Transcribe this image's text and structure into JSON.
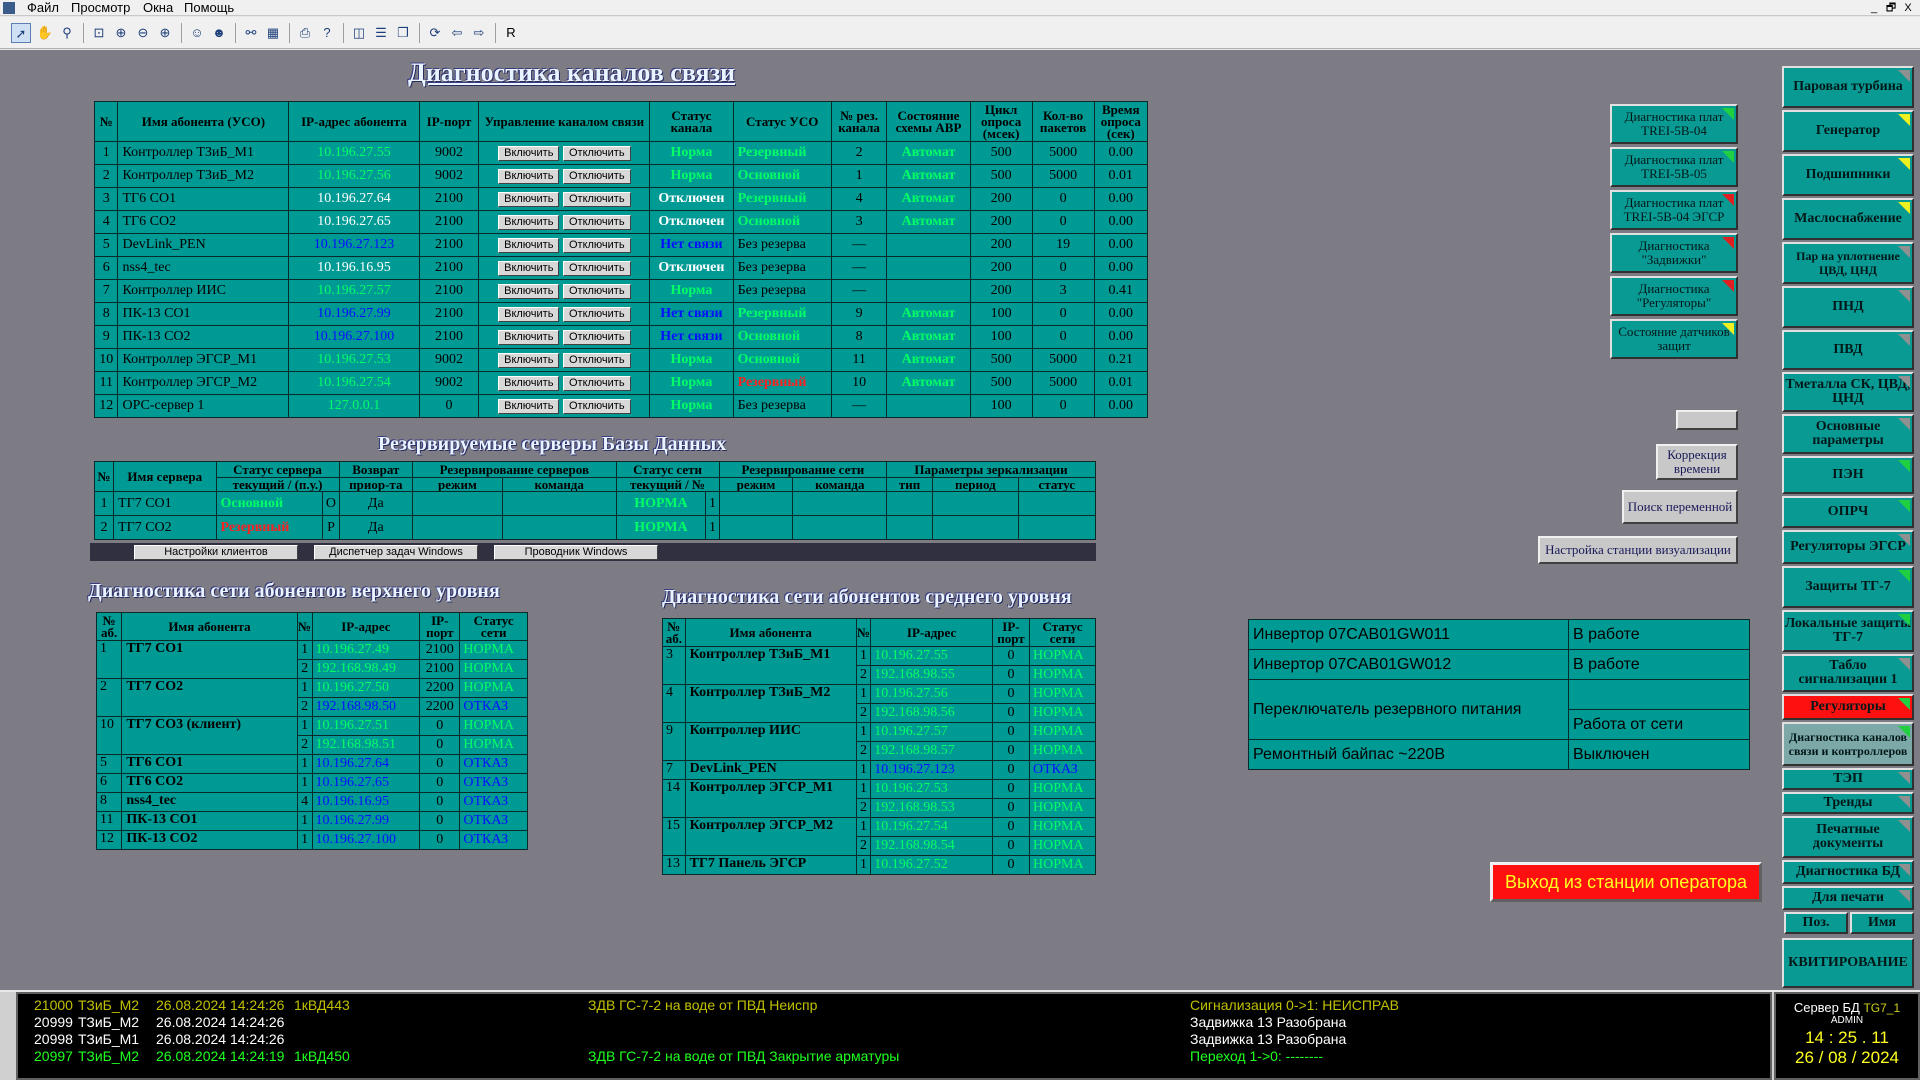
{
  "menu": {
    "items": [
      "Файл",
      "Просмотр",
      "Окна",
      "Помощь"
    ],
    "win_controls": [
      "_",
      "🗗",
      "X"
    ]
  },
  "toolbar": {
    "last": "R"
  },
  "titles": {
    "main": "Диагностика каналов связи",
    "db": "Резервируемые серверы Базы Данных",
    "upper": "Диагностика сети абонентов верхнего уровня",
    "middle": "Диагностика сети абонентов среднего уровня"
  },
  "channels": {
    "headers": [
      "№",
      "Имя абонента (УСО)",
      "IP-адрес абонента",
      "IP-порт",
      "Управление каналом связи",
      "Статус канала",
      "Статус УСО",
      "№ рез. канала",
      "Состояние схемы АВР",
      "Цикл опроса (мсек)",
      "Кол-во пакетов",
      "Время опроса (сек)"
    ],
    "on_label": "Включить",
    "off_label": "Отключить",
    "rows": [
      {
        "n": "1",
        "name": "Контроллер ТЗиБ_М1",
        "ip": "10.196.27.55",
        "ipc": "g",
        "port": "9002",
        "st": "Норма",
        "stc": "g",
        "uso": "Резервный",
        "usoc": "gb",
        "rez": "2",
        "avr": "Автомат",
        "cyc": "500",
        "pk": "5000",
        "t": "0.00"
      },
      {
        "n": "2",
        "name": "Контроллер ТЗиБ_М2",
        "ip": "10.196.27.56",
        "ipc": "g",
        "port": "9002",
        "st": "Норма",
        "stc": "g",
        "uso": "Основной",
        "usoc": "gb",
        "rez": "1",
        "avr": "Автомат",
        "cyc": "500",
        "pk": "5000",
        "t": "0.01"
      },
      {
        "n": "3",
        "name": "ТГ6 СО1",
        "ip": "10.196.27.64",
        "ipc": "w",
        "port": "2100",
        "st": "Отключен",
        "stc": "w",
        "uso": "Резервный",
        "usoc": "gb",
        "rez": "4",
        "avr": "Автомат",
        "cyc": "200",
        "pk": "0",
        "t": "0.00"
      },
      {
        "n": "4",
        "name": "ТГ6 СО2",
        "ip": "10.196.27.65",
        "ipc": "w",
        "port": "2100",
        "st": "Отключен",
        "stc": "w",
        "uso": "Основной",
        "usoc": "gb",
        "rez": "3",
        "avr": "Автомат",
        "cyc": "200",
        "pk": "0",
        "t": "0.00"
      },
      {
        "n": "5",
        "name": "DevLink_PEN",
        "ip": "10.196.27.123",
        "ipc": "b",
        "port": "2100",
        "st": "Нет связи",
        "stc": "b",
        "uso": "Без резерва",
        "usoc": "",
        "rez": "—",
        "avr": "",
        "cyc": "200",
        "pk": "19",
        "t": "0.00"
      },
      {
        "n": "6",
        "name": "nss4_tec",
        "ip": "10.196.16.95",
        "ipc": "w",
        "port": "2100",
        "st": "Отключен",
        "stc": "w",
        "uso": "Без резерва",
        "usoc": "",
        "rez": "—",
        "avr": "",
        "cyc": "200",
        "pk": "0",
        "t": "0.00"
      },
      {
        "n": "7",
        "name": "Контроллер ИИС",
        "ip": "10.196.27.57",
        "ipc": "g",
        "port": "2100",
        "st": "Норма",
        "stc": "g",
        "uso": "Без резерва",
        "usoc": "",
        "rez": "—",
        "avr": "",
        "cyc": "200",
        "pk": "3",
        "t": "0.41"
      },
      {
        "n": "8",
        "name": "ПК-13 СО1",
        "ip": "10.196.27.99",
        "ipc": "b",
        "port": "2100",
        "st": "Нет связи",
        "stc": "b",
        "uso": "Резервный",
        "usoc": "gb",
        "rez": "9",
        "avr": "Автомат",
        "cyc": "100",
        "pk": "0",
        "t": "0.00"
      },
      {
        "n": "9",
        "name": "ПК-13 СО2",
        "ip": "10.196.27.100",
        "ipc": "b",
        "port": "2100",
        "st": "Нет связи",
        "stc": "b",
        "uso": "Основной",
        "usoc": "gb",
        "rez": "8",
        "avr": "Автомат",
        "cyc": "100",
        "pk": "0",
        "t": "0.00"
      },
      {
        "n": "10",
        "name": "Контроллер ЭГСР_М1",
        "ip": "10.196.27.53",
        "ipc": "g",
        "port": "9002",
        "st": "Норма",
        "stc": "g",
        "uso": "Основной",
        "usoc": "gb",
        "rez": "11",
        "avr": "Автомат",
        "cyc": "500",
        "pk": "5000",
        "t": "0.21"
      },
      {
        "n": "11",
        "name": "Контроллер ЭГСР_М2",
        "ip": "10.196.27.54",
        "ipc": "g",
        "port": "9002",
        "st": "Норма",
        "stc": "g",
        "uso": "Резервный",
        "usoc": "r",
        "rez": "10",
        "avr": "Автомат",
        "cyc": "500",
        "pk": "5000",
        "t": "0.01"
      },
      {
        "n": "12",
        "name": "ОРС-сервер 1",
        "ip": "127.0.0.1",
        "ipc": "g",
        "port": "0",
        "st": "Норма",
        "stc": "g",
        "uso": "Без резерва",
        "usoc": "",
        "rez": "—",
        "avr": "",
        "cyc": "100",
        "pk": "0",
        "t": "0.00"
      }
    ]
  },
  "db": {
    "h1": [
      "№",
      "Имя сервера",
      "Статус сервера",
      "Возврат",
      "Резервирование серверов",
      "Статус сети",
      "Резервирование сети",
      "Параметры зеркализации"
    ],
    "h2": [
      "текущий / (п.у.)",
      "приор-та",
      "режим",
      "команда",
      "текущий / №",
      "режим",
      "команда",
      "тип",
      "период",
      "статус"
    ],
    "rows": [
      {
        "n": "1",
        "name": "ТГ7 СО1",
        "st": "Основной",
        "stc": "g",
        "pu": "О",
        "ret": "Да",
        "net": "НОРМА",
        "netn": "1"
      },
      {
        "n": "2",
        "name": "ТГ7 СО2",
        "st": "Резервный",
        "stc": "r",
        "pu": "Р",
        "ret": "Да",
        "net": "НОРМА",
        "netn": "1"
      }
    ],
    "buttons": [
      "Настройки клиентов",
      "Диспетчер задач Windows",
      "Проводник Windows"
    ]
  },
  "upper": {
    "headers": [
      "№ аб.",
      "Имя абонента",
      "№",
      "IP-адрес",
      "IP-порт",
      "Статус сети"
    ],
    "groups": [
      {
        "n": "1",
        "name": "ТГ7 СО1",
        "lines": [
          {
            "k": "1",
            "ip": "10.196.27.49",
            "ipc": "g",
            "port": "2100",
            "st": "НОРМА",
            "stc": "g"
          },
          {
            "k": "2",
            "ip": "192.168.98.49",
            "ipc": "g",
            "port": "2100",
            "st": "НОРМА",
            "stc": "g"
          }
        ]
      },
      {
        "n": "2",
        "name": "ТГ7 СО2",
        "lines": [
          {
            "k": "1",
            "ip": "10.196.27.50",
            "ipc": "g",
            "port": "2200",
            "st": "НОРМА",
            "stc": "g"
          },
          {
            "k": "2",
            "ip": "192.168.98.50",
            "ipc": "b",
            "port": "2200",
            "st": "ОТКАЗ",
            "stc": "b"
          }
        ]
      },
      {
        "n": "10",
        "name": "ТГ7 СО3 (клиент)",
        "lines": [
          {
            "k": "1",
            "ip": "10.196.27.51",
            "ipc": "g",
            "port": "0",
            "st": "НОРМА",
            "stc": "g"
          },
          {
            "k": "2",
            "ip": "192.168.98.51",
            "ipc": "g",
            "port": "0",
            "st": "НОРМА",
            "stc": "g"
          }
        ]
      },
      {
        "n": "5",
        "name": "ТГ6 СО1",
        "lines": [
          {
            "k": "1",
            "ip": "10.196.27.64",
            "ipc": "b",
            "port": "0",
            "st": "ОТКАЗ",
            "stc": "b"
          }
        ]
      },
      {
        "n": "6",
        "name": "ТГ6 СО2",
        "lines": [
          {
            "k": "1",
            "ip": "10.196.27.65",
            "ipc": "b",
            "port": "0",
            "st": "ОТКАЗ",
            "stc": "b"
          }
        ]
      },
      {
        "n": "8",
        "name": "nss4_tec",
        "lines": [
          {
            "k": "4",
            "ip": "10.196.16.95",
            "ipc": "b",
            "port": "0",
            "st": "ОТКАЗ",
            "stc": "b"
          }
        ]
      },
      {
        "n": "11",
        "name": "ПК-13 СО1",
        "lines": [
          {
            "k": "1",
            "ip": "10.196.27.99",
            "ipc": "b",
            "port": "0",
            "st": "ОТКАЗ",
            "stc": "b"
          }
        ]
      },
      {
        "n": "12",
        "name": "ПК-13 СО2",
        "lines": [
          {
            "k": "1",
            "ip": "10.196.27.100",
            "ipc": "b",
            "port": "0",
            "st": "ОТКАЗ",
            "stc": "b"
          }
        ]
      }
    ]
  },
  "middle": {
    "headers": [
      "№ аб.",
      "Имя абонента",
      "№",
      "IP-адрес",
      "IP-порт",
      "Статус сети"
    ],
    "groups": [
      {
        "n": "3",
        "name": "Контроллер ТЗиБ_М1",
        "lines": [
          {
            "k": "1",
            "ip": "10.196.27.55",
            "ipc": "g",
            "port": "0",
            "st": "НОРМА",
            "stc": "g"
          },
          {
            "k": "2",
            "ip": "192.168.98.55",
            "ipc": "g",
            "port": "0",
            "st": "НОРМА",
            "stc": "g"
          }
        ]
      },
      {
        "n": "4",
        "name": "Контроллер ТЗиБ_М2",
        "lines": [
          {
            "k": "1",
            "ip": "10.196.27.56",
            "ipc": "g",
            "port": "0",
            "st": "НОРМА",
            "stc": "g"
          },
          {
            "k": "2",
            "ip": "192.168.98.56",
            "ipc": "g",
            "port": "0",
            "st": "НОРМА",
            "stc": "g"
          }
        ]
      },
      {
        "n": "9",
        "name": "Контроллер ИИС",
        "lines": [
          {
            "k": "1",
            "ip": "10.196.27.57",
            "ipc": "g",
            "port": "0",
            "st": "НОРМА",
            "stc": "g"
          },
          {
            "k": "2",
            "ip": "192.168.98.57",
            "ipc": "g",
            "port": "0",
            "st": "НОРМА",
            "stc": "g"
          }
        ]
      },
      {
        "n": "7",
        "name": "DevLink_PEN",
        "lines": [
          {
            "k": "1",
            "ip": "10.196.27.123",
            "ipc": "b",
            "port": "0",
            "st": "ОТКАЗ",
            "stc": "b"
          }
        ]
      },
      {
        "n": "14",
        "name": "Контроллер ЭГСР_М1",
        "lines": [
          {
            "k": "1",
            "ip": "10.196.27.53",
            "ipc": "g",
            "port": "0",
            "st": "НОРМА",
            "stc": "g"
          },
          {
            "k": "2",
            "ip": "192.168.98.53",
            "ipc": "g",
            "port": "0",
            "st": "НОРМА",
            "stc": "g"
          }
        ]
      },
      {
        "n": "15",
        "name": "Контроллер ЭГСР_М2",
        "lines": [
          {
            "k": "1",
            "ip": "10.196.27.54",
            "ipc": "g",
            "port": "0",
            "st": "НОРМА",
            "stc": "g"
          },
          {
            "k": "2",
            "ip": "192.168.98.54",
            "ipc": "g",
            "port": "0",
            "st": "НОРМА",
            "stc": "g"
          }
        ]
      },
      {
        "n": "13",
        "name": "ТГ7 Панель ЭГСР",
        "lines": [
          {
            "k": "1",
            "ip": "10.196.27.52",
            "ipc": "g",
            "port": "0",
            "st": "НОРМА",
            "stc": "g"
          }
        ]
      }
    ]
  },
  "diag_buttons": [
    {
      "label": "Диагностика плат TREI-5B-04",
      "flag": "gr"
    },
    {
      "label": "Диагностика плат TREI-5B-05",
      "flag": "gr"
    },
    {
      "label": "Диагностика плат TREI-5B-04 ЭГСР",
      "flag": "rd"
    },
    {
      "label": "Диагностика \"Задвижки\"",
      "flag": "rd"
    },
    {
      "label": "Диагностика \"Регуляторы\"",
      "flag": "rd"
    },
    {
      "label": "Состояние датчиков защит",
      "flag": "yl"
    }
  ],
  "side_buttons": {
    "time": "Коррекция времени",
    "search": "Поиск переменной",
    "setup": "Настройка станции визуализации"
  },
  "inverters": [
    {
      "name": "Инвертор 07CAB01GW011",
      "state": "В работе"
    },
    {
      "name": "Инвертор 07CAB01GW012",
      "state": "В работе"
    },
    {
      "name": "Переключатель резервного питания",
      "state": "Работа от сети"
    },
    {
      "name": "Ремонтный байпас ~220В",
      "state": "Выключен"
    }
  ],
  "exit_label": "Выход из станции оператора",
  "nav": [
    {
      "label": "Паровая турбина",
      "flag": ""
    },
    {
      "label": "Генератор",
      "flag": "yl"
    },
    {
      "label": "Подшипники",
      "flag": "yl"
    },
    {
      "label": "Маслоснабжение",
      "flag": "yl"
    },
    {
      "label": "Пар на уплотнение ЦВД, ЦНД",
      "flag": ""
    },
    {
      "label": "ПНД",
      "flag": ""
    },
    {
      "label": "ПВД",
      "flag": ""
    },
    {
      "label": "Тметалла СК, ЦВД, ЦНД",
      "flag": ""
    },
    {
      "label": "Основные параметры",
      "flag": ""
    },
    {
      "label": "ПЭН",
      "flag": "gr"
    },
    {
      "label": "ОПРЧ",
      "flag": "gr"
    },
    {
      "label": "Регуляторы ЭГСР",
      "flag": ""
    },
    {
      "label": "Защиты ТГ-7",
      "flag": "gr"
    },
    {
      "label": "Локальные защиты ТГ-7",
      "flag": "gr"
    },
    {
      "label": "Табло сигнализации 1",
      "flag": ""
    },
    {
      "label": "Регуляторы",
      "flag": "gr",
      "red": true
    },
    {
      "label": "Диагностика каналов связи и контроллеров",
      "flag": "gr",
      "active": true
    },
    {
      "label": "ТЭП",
      "flag": ""
    },
    {
      "label": "Тренды",
      "flag": ""
    },
    {
      "label": "Печатные документы",
      "flag": ""
    },
    {
      "label": "Диагностика БД",
      "flag": ""
    },
    {
      "label": "Для печати",
      "flag": ""
    }
  ],
  "nav_tabs": [
    "Поз.",
    "Имя"
  ],
  "ack": "КВИТИРОВАНИЕ",
  "alarms": [
    {
      "code": "21000",
      "src": "ТЗиБ_М2",
      "time": "26.08.2024 14:24:26",
      "tag": "1кВД443",
      "msg": "ЗДВ ГС-7-2 на воде от ПВД Неиспр",
      "sig": "Сигнализация  0->1:  НЕИСПРАВ",
      "color": "#c0c000"
    },
    {
      "code": "20999",
      "src": "ТЗиБ_М2",
      "time": "26.08.2024 14:24:26",
      "tag": "",
      "msg": "",
      "sig": "Задвижка   13 Разобрана",
      "color": "#ffffff"
    },
    {
      "code": "20998",
      "src": "ТЗиБ_М1",
      "time": "26.08.2024 14:24:26",
      "tag": "",
      "msg": "",
      "sig": "Задвижка   13 Разобрана",
      "color": "#ffffff"
    },
    {
      "code": "20997",
      "src": "ТЗиБ_М2",
      "time": "26.08.2024 14:24:19",
      "tag": "1кВД450",
      "msg": "ЗДВ ГС-7-2 на воде от ПВД Закрытие арматуры",
      "sig": "Переход  1->0:  --------",
      "color": "#20ff20"
    }
  ],
  "clock": {
    "server": "Сервер БД",
    "node": "TG7_1",
    "user": "ADMIN",
    "time": "14 : 25 . 11",
    "date": "26 / 08 / 2024"
  }
}
